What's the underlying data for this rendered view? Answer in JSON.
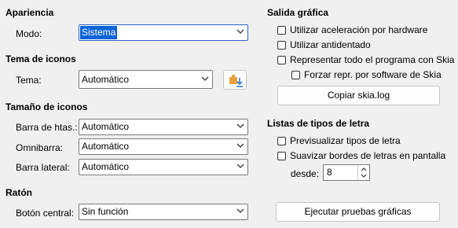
{
  "appearance": {
    "heading": "Apariencia",
    "mode_label": "Modo:",
    "mode_value": "Sistema"
  },
  "icon_theme": {
    "heading": "Tema de iconos",
    "theme_label": "Tema:",
    "theme_value": "Automático"
  },
  "icon_size": {
    "heading": "Tamaño de iconos",
    "toolbar_label": "Barra de htas.:",
    "toolbar_value": "Automático",
    "notebookbar_label": "Omnibarra:",
    "notebookbar_value": "Automático",
    "sidebar_label": "Barra lateral:",
    "sidebar_value": "Automático"
  },
  "mouse": {
    "heading": "Ratón",
    "middle_label": "Botón central:",
    "middle_value": "Sin función"
  },
  "graphics": {
    "heading": "Salida gráfica",
    "hw_accel": "Utilizar aceleración por hardware",
    "antialias": "Utilizar antidentado",
    "skia_all": "Representar todo el programa con Skia",
    "skia_sw": "Forzar repr. por software de Skia",
    "copy_log": "Copiar skia.log"
  },
  "font_lists": {
    "heading": "Listas de tipos de letra",
    "preview": "Previsualizar tipos de letra",
    "smooth": "Suavizar bordes de letras en pantalla",
    "from_label": "desde:",
    "from_value": "8"
  },
  "run_tests": "Ejecutar pruebas gráficas",
  "colors": {
    "selection": "#0a64d8",
    "icon_orange": "#e8a23c",
    "icon_blue": "#2f7dd1"
  }
}
